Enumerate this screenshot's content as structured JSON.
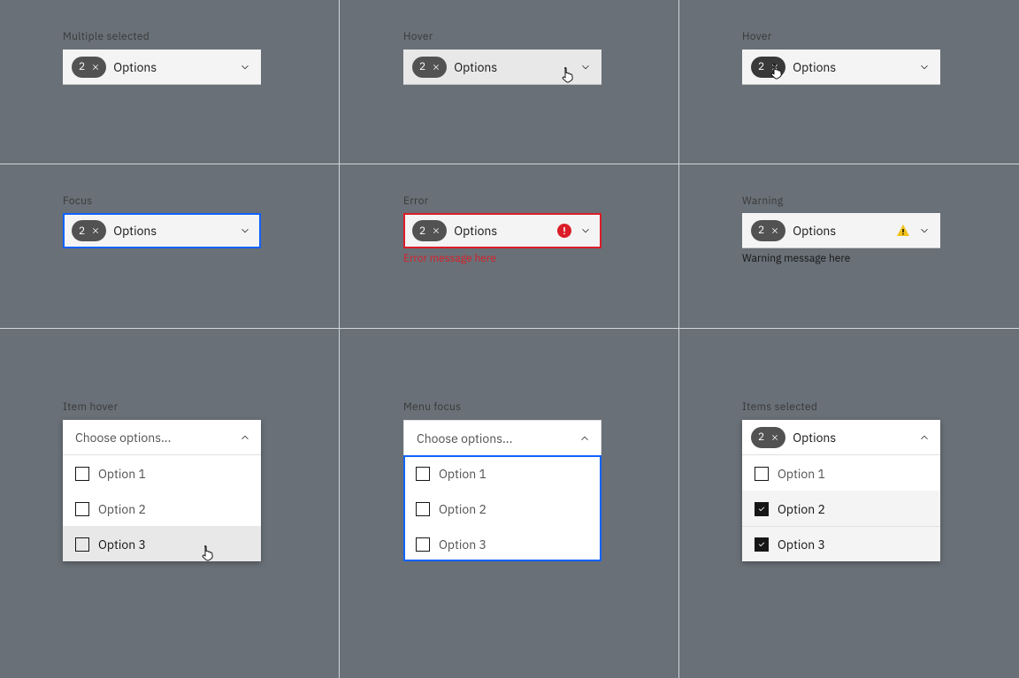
{
  "states": {
    "multipleSelected": {
      "label": "Multiple selected",
      "count": 2,
      "text": "Options"
    },
    "hover": {
      "label": "Hover",
      "count": 2,
      "text": "Options"
    },
    "hoverTag": {
      "label": "Hover",
      "count": 2,
      "text": "Options"
    },
    "focus": {
      "label": "Focus",
      "count": 2,
      "text": "Options"
    },
    "error": {
      "label": "Error",
      "count": 2,
      "text": "Options",
      "message": "Error message here"
    },
    "warning": {
      "label": "Warning",
      "count": 2,
      "text": "Options",
      "message": "Warning message here"
    },
    "itemHover": {
      "label": "Item hover",
      "placeholder": "Choose options...",
      "options": [
        {
          "label": "Option 1",
          "checked": false,
          "hover": false
        },
        {
          "label": "Option 2",
          "checked": false,
          "hover": false
        },
        {
          "label": "Option 3",
          "checked": false,
          "hover": true
        }
      ]
    },
    "menuFocus": {
      "label": "Menu focus",
      "placeholder": "Choose options...",
      "options": [
        {
          "label": "Option 1",
          "checked": false
        },
        {
          "label": "Option 2",
          "checked": false
        },
        {
          "label": "Option 3",
          "checked": false
        }
      ]
    },
    "itemsSelected": {
      "label": "Items selected",
      "count": 2,
      "text": "Options",
      "options": [
        {
          "label": "Option 1",
          "checked": false
        },
        {
          "label": "Option 2",
          "checked": true
        },
        {
          "label": "Option 3",
          "checked": true
        }
      ]
    }
  }
}
